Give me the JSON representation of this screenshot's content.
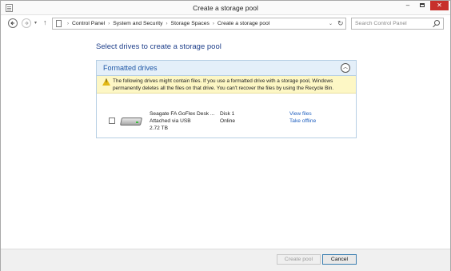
{
  "window": {
    "title": "Create a storage pool",
    "controls": {
      "minimize": "‒",
      "close": "✕"
    }
  },
  "nav": {
    "back_icon": "back-arrow-icon",
    "forward_icon": "forward-arrow-icon",
    "recent_glyph": "▾",
    "up_glyph": "↑",
    "breadcrumbs": [
      "Control Panel",
      "System and Security",
      "Storage Spaces",
      "Create a storage pool"
    ],
    "breadcrumb_sep": "›",
    "dropdown_glyph": "⌄",
    "refresh_glyph": "↻",
    "search_placeholder": "Search Control Panel"
  },
  "main": {
    "heading": "Select drives to create a storage pool",
    "section": {
      "title": "Formatted drives",
      "collapse_glyph": "︿",
      "warning": "The following drives might contain files. If you use a formatted drive with a storage pool, Windows permanently deletes all the files on that drive. You can't recover the files by using the Recycle Bin.",
      "drives": [
        {
          "name": "Seagate FA GoFlex Desk ...",
          "connection": "Attached via USB",
          "size": "2.72 TB",
          "disk": "Disk 1",
          "status": "Online",
          "links": [
            "View files",
            "Take offline"
          ],
          "checked": false
        }
      ]
    }
  },
  "footer": {
    "create_label": "Create pool",
    "cancel_label": "Cancel"
  },
  "colors": {
    "accent": "#1f57a6",
    "heading": "#1e3f8a",
    "warning_bg": "#fdf7c5",
    "close_button": "#c7302b"
  }
}
